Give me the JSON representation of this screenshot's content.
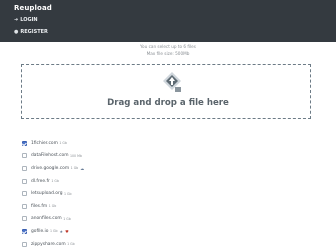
{
  "app": {
    "title": "Reupload"
  },
  "nav": {
    "login": "LOGIN",
    "register": "REGISTER"
  },
  "info": {
    "line1": "You can select up to 6 files",
    "line2": "Max file size: 500Mb"
  },
  "dropzone": {
    "label": "Drag and drop a file here"
  },
  "hosts": [
    {
      "name": "1fichier.com",
      "size": "1 Gb",
      "checked": true,
      "badges": []
    },
    {
      "name": "dataFilehost.com",
      "size": "100 Mb",
      "checked": false,
      "badges": []
    },
    {
      "name": "drive.google.com",
      "size": "1 Gb",
      "checked": false,
      "badges": [
        "cloud-icon"
      ]
    },
    {
      "name": "dl.free.fr",
      "size": "1 Gb",
      "checked": false,
      "badges": []
    },
    {
      "name": "letsupload.org",
      "size": "1 Gb",
      "checked": false,
      "badges": []
    },
    {
      "name": "files.fm",
      "size": "1 Gb",
      "checked": false,
      "badges": []
    },
    {
      "name": "anonfiles.com",
      "size": "1 Gb",
      "checked": false,
      "badges": []
    },
    {
      "name": "gofile.io",
      "size": "1 Gb",
      "checked": true,
      "badges": [
        "star-icon",
        "heart-icon"
      ]
    },
    {
      "name": "zippyshare.com",
      "size": "1 Gb",
      "checked": false,
      "badges": []
    }
  ],
  "colors": {
    "topbar": "#343a40",
    "accent": "#4a73c9",
    "dropzone_border": "#6c7b86"
  }
}
